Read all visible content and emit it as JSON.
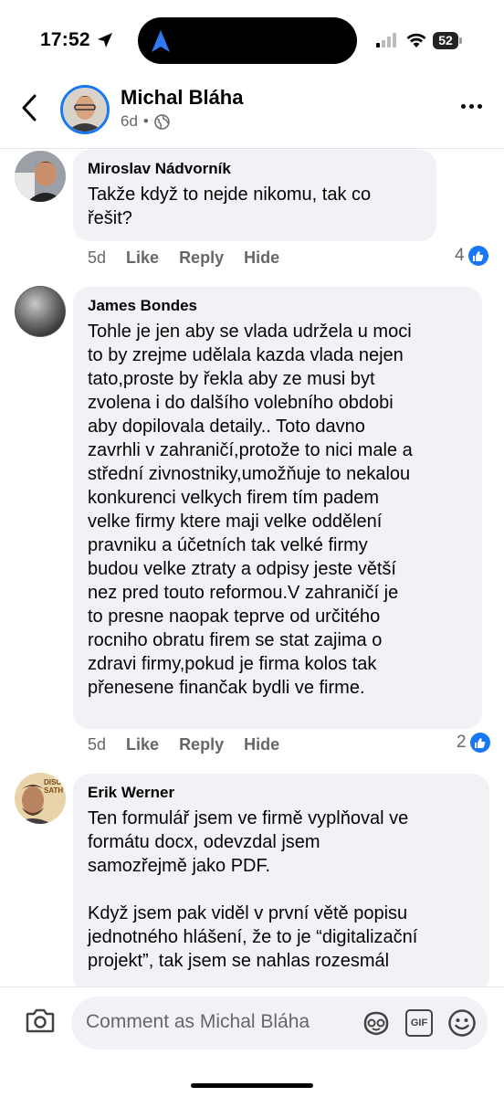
{
  "status_bar": {
    "time": "17:52",
    "battery": "52"
  },
  "header": {
    "author": "Michal Bláha",
    "time_ago": "6d",
    "separator": "•"
  },
  "comments": [
    {
      "author": "Miroslav Nádvorník",
      "text": "Takže když to nejde nikomu, tak co\nřešit?",
      "time_ago": "5d",
      "actions": [
        "Like",
        "Reply",
        "Hide"
      ],
      "reactions": "4"
    },
    {
      "author": "James Bondes",
      "text": "Tohle je jen aby se vlada udržela u moci\nto by zrejme udělala kazda vlada nejen\ntato,proste by řekla aby ze musi byt\nzvolena i do dalšího volebního obdobi\naby dopilovala detaily.. Toto davno\nzavrhli v zahraničí,protože to nici male a\nstřední zivnostniky,umožňuje to nekalou\nkonkurenci velkych firem tím padem\nvelke firmy ktere maji velke oddělení\npravniku a účetních tak velké firmy\nbudou velke ztraty a odpisy jeste větší\nnez pred touto reformou.V zahraničí je\nto presne naopak teprve od určitého\nrocniho obratu firem se stat zajima o\nzdravi firmy,pokud je firma kolos tak\npřenesene finančak bydli ve firme.",
      "time_ago": "5d",
      "actions": [
        "Like",
        "Reply",
        "Hide"
      ],
      "reactions": "2"
    },
    {
      "author": "Erik Werner",
      "text": "Ten formulář jsem ve firmě vyplňoval ve\nformátu docx, odevzdal jsem\nsamozřejmě jako PDF.\n\nKdyž jsem pak viděl v první větě popisu\njednotného hlášení, že to je “digitalizační\nprojekt”, tak jsem se nahlas rozesmál",
      "avatar_text": "DISC SATH"
    }
  ],
  "composer": {
    "placeholder": "Comment as Michal Bláha",
    "gif_label": "GIF"
  }
}
